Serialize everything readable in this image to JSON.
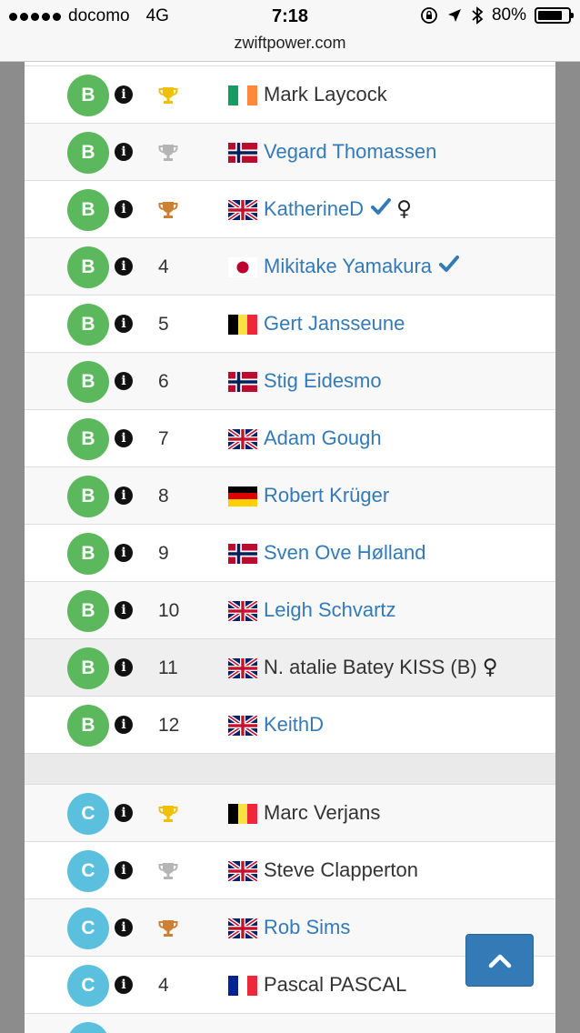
{
  "status_bar": {
    "carrier": "docomo",
    "network": "4G",
    "time": "7:18",
    "battery": "80%",
    "battery_level": 0.8
  },
  "browser": {
    "url": "zwiftpower.com"
  },
  "colors": {
    "cat_B": "#5cb85c",
    "cat_C": "#5bc0de",
    "link": "#337ab7",
    "gold": "#f0c000",
    "silver": "#b5b5b5",
    "bronze": "#cd7f32"
  },
  "groups": [
    {
      "category": "B",
      "rows": [
        {
          "cat": "B",
          "pos": "",
          "trophy": "gold",
          "flag": "ie",
          "name": "Mark Laycock",
          "link": false,
          "verified": false,
          "female": false,
          "bg": "white"
        },
        {
          "cat": "B",
          "pos": "",
          "trophy": "silver",
          "flag": "no",
          "name": "Vegard Thomassen",
          "link": true,
          "verified": false,
          "female": false,
          "bg": "alt"
        },
        {
          "cat": "B",
          "pos": "",
          "trophy": "bronze",
          "flag": "gb",
          "name": "KatherineD",
          "link": true,
          "verified": true,
          "female": true,
          "bg": "white"
        },
        {
          "cat": "B",
          "pos": "4",
          "trophy": "",
          "flag": "jp",
          "name": "Mikitake Yamakura",
          "link": true,
          "verified": true,
          "female": false,
          "bg": "alt"
        },
        {
          "cat": "B",
          "pos": "5",
          "trophy": "",
          "flag": "be",
          "name": "Gert Jansseune",
          "link": true,
          "verified": false,
          "female": false,
          "bg": "white"
        },
        {
          "cat": "B",
          "pos": "6",
          "trophy": "",
          "flag": "no",
          "name": "Stig Eidesmo",
          "link": true,
          "verified": false,
          "female": false,
          "bg": "alt"
        },
        {
          "cat": "B",
          "pos": "7",
          "trophy": "",
          "flag": "gb",
          "name": "Adam Gough",
          "link": true,
          "verified": false,
          "female": false,
          "bg": "white"
        },
        {
          "cat": "B",
          "pos": "8",
          "trophy": "",
          "flag": "de",
          "name": "Robert Krüger",
          "link": true,
          "verified": false,
          "female": false,
          "bg": "alt"
        },
        {
          "cat": "B",
          "pos": "9",
          "trophy": "",
          "flag": "no",
          "name": "Sven Ove Hølland",
          "link": true,
          "verified": false,
          "female": false,
          "bg": "white"
        },
        {
          "cat": "B",
          "pos": "10",
          "trophy": "",
          "flag": "gb",
          "name": "Leigh Schvartz",
          "link": true,
          "verified": false,
          "female": false,
          "bg": "alt"
        },
        {
          "cat": "B",
          "pos": "11",
          "trophy": "",
          "flag": "gb",
          "name": "N. atalie Batey KISS (B)",
          "link": false,
          "verified": false,
          "female": true,
          "bg": "hl"
        },
        {
          "cat": "B",
          "pos": "12",
          "trophy": "",
          "flag": "gb",
          "name": "KeithD",
          "link": true,
          "verified": false,
          "female": false,
          "bg": "white"
        }
      ]
    },
    {
      "category": "C",
      "rows": [
        {
          "cat": "C",
          "pos": "",
          "trophy": "gold",
          "flag": "be",
          "name": "Marc Verjans",
          "link": false,
          "verified": false,
          "female": false,
          "bg": "alt"
        },
        {
          "cat": "C",
          "pos": "",
          "trophy": "silver",
          "flag": "gb",
          "name": "Steve Clapperton",
          "link": false,
          "verified": false,
          "female": false,
          "bg": "white"
        },
        {
          "cat": "C",
          "pos": "",
          "trophy": "bronze",
          "flag": "gb",
          "name": "Rob Sims",
          "link": true,
          "verified": false,
          "female": false,
          "bg": "alt"
        },
        {
          "cat": "C",
          "pos": "4",
          "trophy": "",
          "flag": "fr",
          "name": "Pascal PASCAL",
          "link": false,
          "verified": false,
          "female": false,
          "bg": "white"
        },
        {
          "cat": "C",
          "pos": "",
          "trophy": "",
          "flag": "gb",
          "name": "",
          "link": false,
          "verified": false,
          "female": false,
          "bg": "alt"
        }
      ]
    }
  ],
  "info_glyph": "i",
  "female_glyph": "♀",
  "scroll_top_icon": "chevron-up-icon"
}
